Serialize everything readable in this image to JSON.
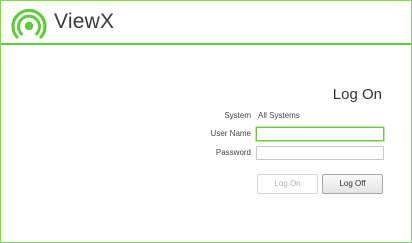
{
  "app": {
    "name": "ViewX"
  },
  "login": {
    "title": "Log On",
    "system_label": "System",
    "system_value": "All Systems",
    "username_label": "User Name",
    "username_value": "",
    "password_label": "Password",
    "password_value": "",
    "logon_label": "Log On",
    "logoff_label": "Log Off"
  },
  "colors": {
    "accent": "#5dcb3b",
    "frame": "#7ed957",
    "focus": "#6cc84a"
  },
  "icons": {
    "logo": "viewx-logo-icon"
  }
}
